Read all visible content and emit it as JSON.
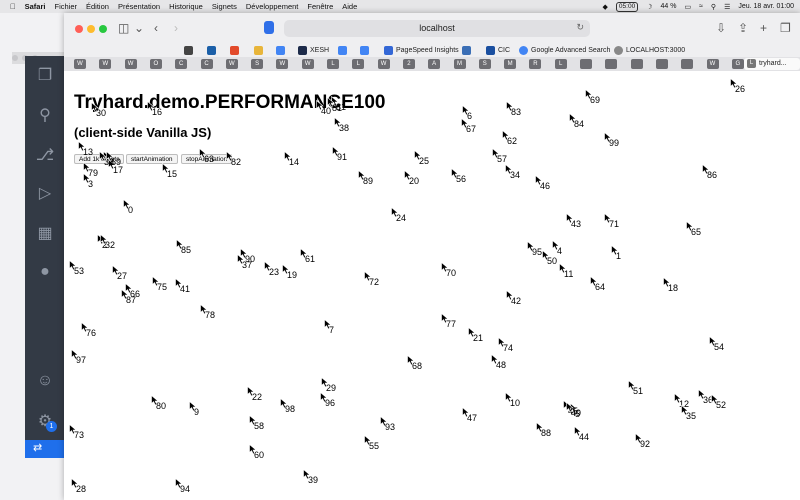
{
  "menubar": {
    "app": "Safari",
    "items": [
      "Fichier",
      "Édition",
      "Présentation",
      "Historique",
      "Signets",
      "Développement",
      "Fenêtre",
      "Aide"
    ],
    "clock": "05:00",
    "battery": "44 %",
    "datetime": "Jeu. 18 avr.  01:00"
  },
  "browser": {
    "address": "localhost",
    "bookmarks": [
      "XESH",
      "PageSpeed Insights",
      "CIC",
      "Google Advanced Search",
      "LOCALHOST:3000"
    ],
    "tab_letters": [
      "W",
      "W",
      "W",
      "O",
      "C",
      "C",
      "W",
      "S",
      "W",
      "W",
      "L",
      "L",
      "W",
      "2",
      "A",
      "M",
      "S",
      "M",
      "R",
      "L",
      "",
      "",
      "",
      "",
      "",
      "W",
      "G"
    ],
    "active_tab": "tryhard...",
    "colors": {
      "close": "#ff5f57",
      "minimize": "#febc2e",
      "zoom": "#28c840",
      "accent": "#2f6fe8"
    }
  },
  "page": {
    "title": "Tryhard.demo.PERFORMANCE100",
    "subtitle": "(client-side Vanilla JS)",
    "buttons": {
      "add_clients": "Add 1k clients",
      "start": "startAnimation",
      "stop": "stopAnimation"
    },
    "cursors": [
      {
        "label": "0"
      },
      {
        "label": "1"
      },
      {
        "label": "2"
      },
      {
        "label": "3"
      },
      {
        "label": "4"
      },
      {
        "label": "5"
      },
      {
        "label": "6"
      },
      {
        "label": "7"
      },
      {
        "label": "8"
      },
      {
        "label": "9"
      },
      {
        "label": "10"
      },
      {
        "label": "11"
      },
      {
        "label": "12"
      },
      {
        "label": "13"
      },
      {
        "label": "14"
      },
      {
        "label": "15"
      },
      {
        "label": "16"
      },
      {
        "label": "17"
      },
      {
        "label": "18"
      },
      {
        "label": "19"
      },
      {
        "label": "20"
      },
      {
        "label": "21"
      },
      {
        "label": "22"
      },
      {
        "label": "23"
      },
      {
        "label": "24"
      },
      {
        "label": "25"
      },
      {
        "label": "26"
      },
      {
        "label": "27"
      },
      {
        "label": "28"
      },
      {
        "label": "29"
      },
      {
        "label": "30"
      },
      {
        "label": "31"
      },
      {
        "label": "32"
      },
      {
        "label": "33"
      },
      {
        "label": "34"
      },
      {
        "label": "35"
      },
      {
        "label": "36"
      },
      {
        "label": "37"
      },
      {
        "label": "38"
      },
      {
        "label": "39"
      },
      {
        "label": "40"
      },
      {
        "label": "41"
      },
      {
        "label": "42"
      },
      {
        "label": "43"
      },
      {
        "label": "44"
      },
      {
        "label": "45"
      },
      {
        "label": "46"
      },
      {
        "label": "47"
      },
      {
        "label": "48"
      },
      {
        "label": "49"
      },
      {
        "label": "50"
      },
      {
        "label": "51"
      },
      {
        "label": "52"
      },
      {
        "label": "53"
      },
      {
        "label": "54"
      },
      {
        "label": "55"
      },
      {
        "label": "56"
      },
      {
        "label": "57"
      },
      {
        "label": "58"
      },
      {
        "label": "59"
      },
      {
        "label": "60"
      },
      {
        "label": "61"
      },
      {
        "label": "62"
      },
      {
        "label": "63"
      },
      {
        "label": "64"
      },
      {
        "label": "65"
      },
      {
        "label": "66"
      },
      {
        "label": "67"
      },
      {
        "label": "68"
      },
      {
        "label": "69"
      },
      {
        "label": "70"
      },
      {
        "label": "71"
      },
      {
        "label": "72"
      },
      {
        "label": "73"
      },
      {
        "label": "74"
      },
      {
        "label": "75"
      },
      {
        "label": "76"
      },
      {
        "label": "77"
      },
      {
        "label": "78"
      },
      {
        "label": "79"
      },
      {
        "label": "80"
      },
      {
        "label": "81"
      },
      {
        "label": "82"
      },
      {
        "label": "83"
      },
      {
        "label": "84"
      },
      {
        "label": "85"
      },
      {
        "label": "86"
      },
      {
        "label": "87"
      },
      {
        "label": "88"
      },
      {
        "label": "89"
      },
      {
        "label": "90"
      },
      {
        "label": "91"
      },
      {
        "label": "92"
      },
      {
        "label": "93"
      },
      {
        "label": "94"
      },
      {
        "label": "95"
      },
      {
        "label": "96"
      },
      {
        "label": "97"
      },
      {
        "label": "98"
      },
      {
        "label": "99"
      }
    ]
  },
  "vscode": {
    "badge": "1"
  }
}
